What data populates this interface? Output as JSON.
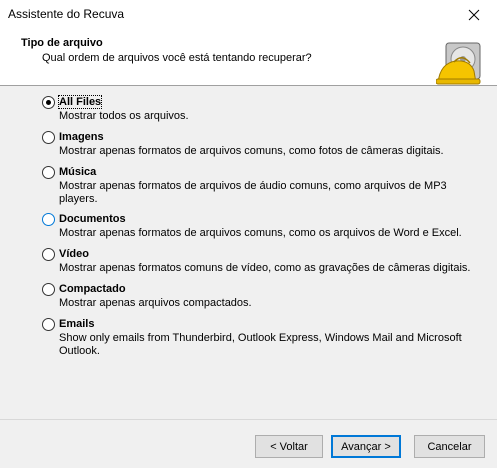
{
  "window": {
    "title": "Assistente do Recuva"
  },
  "header": {
    "title": "Tipo de arquivo",
    "subtitle": "Qual ordem de arquivos você está tentando recuperar?"
  },
  "options": [
    {
      "label": "All Files",
      "description": "Mostrar todos os arquivos.",
      "selected": true
    },
    {
      "label": "Imagens",
      "description": "Mostrar apenas formatos de arquivos comuns, como fotos de câmeras digitais.",
      "selected": false
    },
    {
      "label": "Música",
      "description": "Mostrar apenas formatos de arquivos de áudio comuns, como arquivos de MP3 players.",
      "selected": false
    },
    {
      "label": "Documentos",
      "description": "Mostrar apenas formatos de arquivos comuns, como os arquivos de Word e Excel.",
      "selected": false
    },
    {
      "label": "Vídeo",
      "description": "Mostrar apenas formatos comuns de vídeo, como as gravações de câmeras digitais.",
      "selected": false
    },
    {
      "label": "Compactado",
      "description": "Mostrar apenas arquivos compactados.",
      "selected": false
    },
    {
      "label": "Emails",
      "description": "Show only emails from Thunderbird, Outlook Express, Windows Mail and Microsoft Outlook.",
      "selected": false
    }
  ],
  "buttons": {
    "back": "< Voltar",
    "next": "Avançar >",
    "cancel": "Cancelar"
  },
  "colors": {
    "accent": "#0078d7",
    "logo_yellow": "#f5c400"
  }
}
